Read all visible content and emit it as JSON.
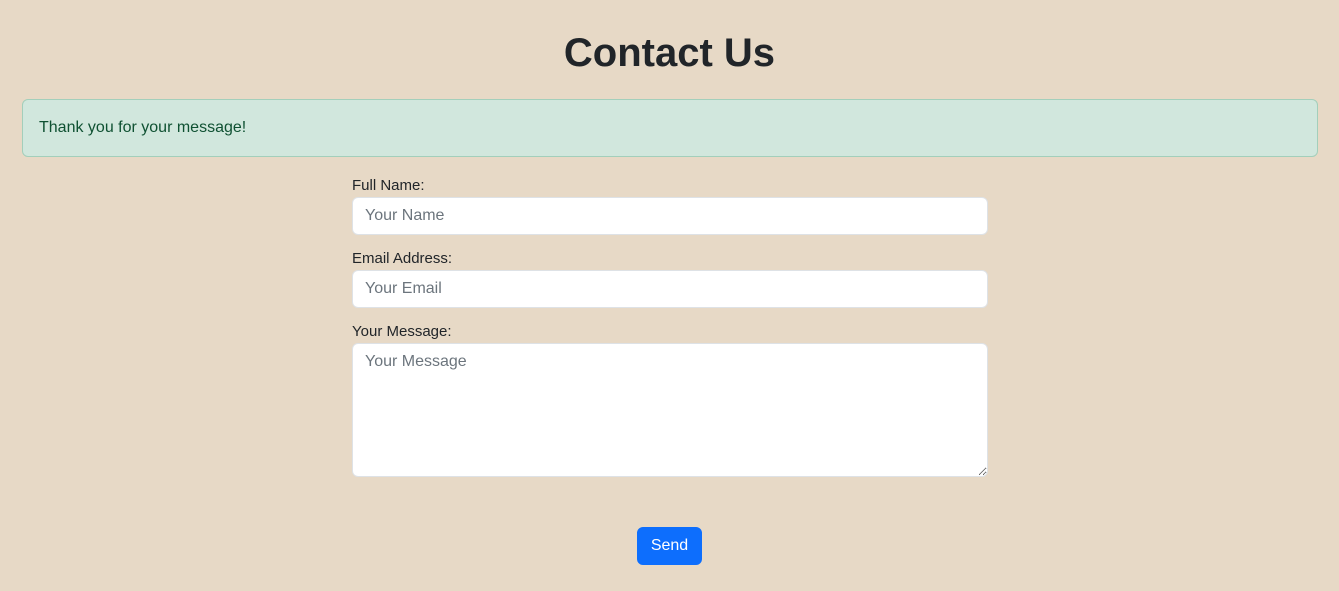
{
  "page": {
    "title": "Contact Us"
  },
  "alert": {
    "message": "Thank you for your message!"
  },
  "form": {
    "name": {
      "label": "Full Name:",
      "placeholder": "Your Name",
      "value": ""
    },
    "email": {
      "label": "Email Address:",
      "placeholder": "Your Email",
      "value": ""
    },
    "message": {
      "label": "Your Message:",
      "placeholder": "Your Message",
      "value": ""
    },
    "submit_label": "Send"
  },
  "colors": {
    "background": "#e7d9c6",
    "alert_background": "#d1e7dd",
    "alert_text": "#0f5132",
    "primary_button": "#0d6efd"
  }
}
